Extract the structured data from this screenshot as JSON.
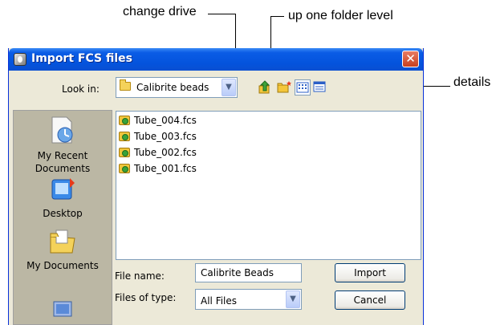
{
  "annotations": {
    "change_drive": "change drive",
    "up_one_level": "up one folder level",
    "details": "details"
  },
  "dialog": {
    "title": "Import FCS files",
    "look_in_label": "Look in:",
    "look_in_value": "Calibrite beads",
    "places": [
      {
        "label": "My Recent Documents",
        "icon": "recent-documents-icon"
      },
      {
        "label": "Desktop",
        "icon": "desktop-icon"
      },
      {
        "label": "My Documents",
        "icon": "my-documents-icon"
      }
    ],
    "files": [
      "Tube_004.fcs",
      "Tube_003.fcs",
      "Tube_002.fcs",
      "Tube_001.fcs"
    ],
    "file_name_label": "File name:",
    "file_name_value": "Calibrite Beads",
    "file_type_label": "Files of type:",
    "file_type_value": "All Files",
    "import_label": "Import",
    "cancel_label": "Cancel"
  },
  "colors": {
    "titlebar": "#0453dc",
    "window_bg": "#ece9d8",
    "places_bar": "#bbb7a4",
    "close_button": "#c9401f"
  }
}
